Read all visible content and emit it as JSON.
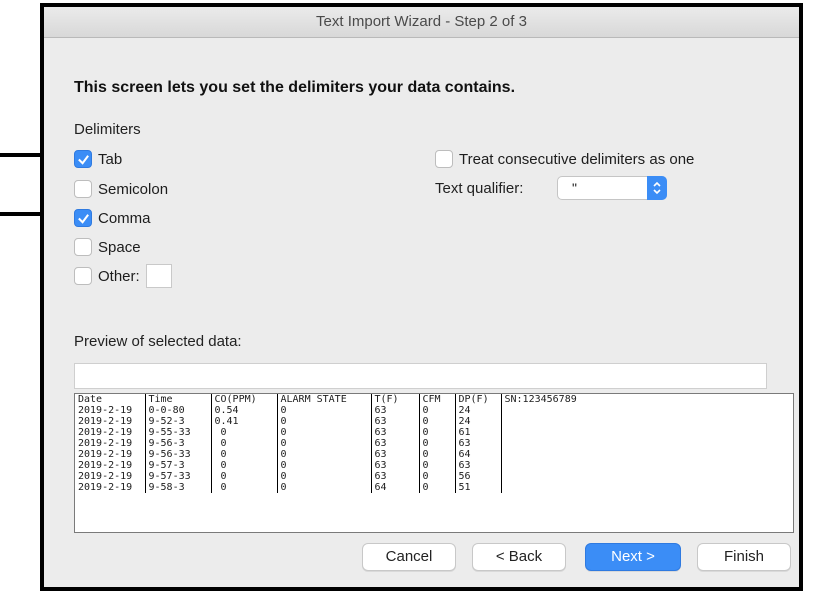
{
  "window": {
    "title": "Text Import Wizard - Step 2 of 3"
  },
  "heading": "This screen lets you set the delimiters your data contains.",
  "delimiters": {
    "label": "Delimiters",
    "tab": {
      "label": "Tab",
      "checked": true
    },
    "semicolon": {
      "label": "Semicolon",
      "checked": false
    },
    "comma": {
      "label": "Comma",
      "checked": true
    },
    "space": {
      "label": "Space",
      "checked": false
    },
    "other": {
      "label": "Other:",
      "checked": false,
      "value": ""
    }
  },
  "options": {
    "consecutive_label": "Treat consecutive delimiters as one",
    "consecutive_checked": false,
    "qualifier_label": "Text qualifier:",
    "qualifier_value": "\""
  },
  "preview": {
    "label": "Preview of selected data:",
    "rows": [
      [
        "Date",
        "Time",
        "CO(PPM)",
        "ALARM STATE",
        "T(F)",
        "CFM",
        "DP(F)",
        "SN:123456789"
      ],
      [
        "2019-2-19",
        "0-0-80",
        "0.54",
        "0",
        "63",
        "0",
        "24",
        ""
      ],
      [
        "2019-2-19",
        "9-52-3",
        "0.41",
        "0",
        "63",
        "0",
        "24",
        ""
      ],
      [
        "2019-2-19",
        "9-55-33",
        " 0",
        "0",
        "63",
        "0",
        "61",
        ""
      ],
      [
        "2019-2-19",
        "9-56-3",
        " 0",
        "0",
        "63",
        "0",
        "63",
        ""
      ],
      [
        "2019-2-19",
        "9-56-33",
        " 0",
        "0",
        "63",
        "0",
        "64",
        ""
      ],
      [
        "2019-2-19",
        "9-57-3",
        " 0",
        "0",
        "63",
        "0",
        "63",
        ""
      ],
      [
        "2019-2-19",
        "9-57-33",
        " 0",
        "0",
        "63",
        "0",
        "56",
        ""
      ],
      [
        "2019-2-19",
        "9-58-3",
        " 0",
        "0",
        "64",
        "0",
        "51",
        ""
      ]
    ]
  },
  "buttons": {
    "cancel": "Cancel",
    "back": "< Back",
    "next": "Next >",
    "finish": "Finish"
  },
  "colors": {
    "accent": "#3b8df6",
    "window_bg": "#ececec"
  }
}
